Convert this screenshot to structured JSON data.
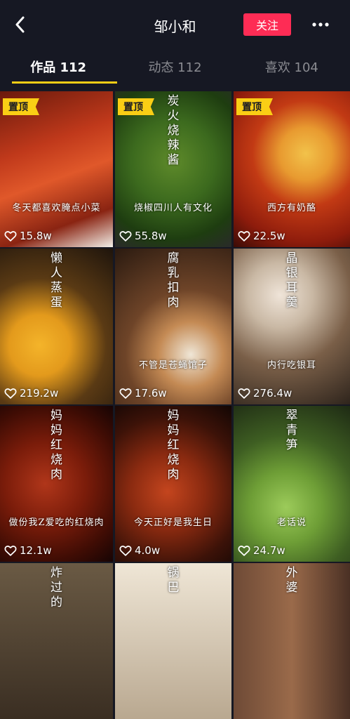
{
  "header": {
    "title": "邹小和",
    "follow_label": "关注",
    "back_icon": "chevron-left-icon",
    "more_icon": "more-dots-icon"
  },
  "tabs": [
    {
      "label": "作品 112",
      "active": true
    },
    {
      "label": "动态 112",
      "active": false
    },
    {
      "label": "喜欢 104",
      "active": false
    }
  ],
  "colors": {
    "background": "#161823",
    "accent_red": "#fe2c55",
    "tab_indicator": "#face15",
    "pin_badge": "#face15"
  },
  "videos": [
    {
      "pinned": "置顶",
      "vcaption": "",
      "hcaption": "冬天都喜欢腌点小菜",
      "likes": "15.8w",
      "bg": "linear-gradient(160deg,#6b1a0c 0%,#c0391b 35%,#e0582a 55%,#8a2412 80%,#f2efe8 100%)"
    },
    {
      "pinned": "置顶",
      "vcaption": "炭火烧辣酱",
      "hcaption": "烧椒四川人有文化",
      "likes": "55.8w",
      "bg": "radial-gradient(circle at 50% 45%,#5e8a2a 0%,#3c6a1e 40%,#1e3d10 75%,#2a2a2a 100%)"
    },
    {
      "pinned": "置顶",
      "vcaption": "",
      "hcaption": "西方有奶酪",
      "likes": "22.5w",
      "bg": "radial-gradient(circle at 62% 40%,#f2c24a 0%,#e89a30 22%,#c23a14 45%,#8e1c0c 75%,#3a0c06 100%)"
    },
    {
      "pinned": "",
      "vcaption": "懒人蒸蛋",
      "hcaption": "",
      "likes": "219.2w",
      "bg": "radial-gradient(circle at 35% 62%,#f4b42a 0%,#e39a1c 25%,#5a3a14 55%,#1e140c 100%)"
    },
    {
      "pinned": "",
      "vcaption": "腐乳扣肉",
      "hcaption": "不管是苍蝇馆子",
      "likes": "17.6w",
      "bg": "radial-gradient(circle at 65% 68%,#efe6d6 0%,#c48a54 25%,#6e4428 50%,#2a1a10 100%)"
    },
    {
      "pinned": "",
      "vcaption": "晶银耳羹",
      "hcaption": "内行吃银耳",
      "likes": "276.4w",
      "bg": "radial-gradient(circle at 40% 30%,#efe4d8 0%,#c9b8a4 25%,#7a5f48 55%,#2e241c 100%)"
    },
    {
      "pinned": "",
      "vcaption": "妈妈红烧肉",
      "hcaption": "做份我Z爱吃的红烧肉",
      "likes": "12.1w",
      "bg": "radial-gradient(circle at 40% 50%,#b0361a 0%,#7a1c0a 40%,#3e0c04 75%,#160404 100%)"
    },
    {
      "pinned": "",
      "vcaption": "妈妈红烧肉",
      "hcaption": "今天正好是我生日",
      "likes": "4.0w",
      "bg": "radial-gradient(circle at 45% 55%,#c4451e 0%,#8a2a10 35%,#3c1208 70%,#120604 100%)"
    },
    {
      "pinned": "",
      "vcaption": "翠青笋",
      "hcaption": "老话说",
      "likes": "24.7w",
      "bg": "radial-gradient(circle at 45% 65%,#9ccb5a 0%,#6e9e36 30%,#3e5e22 60%,#1e2a14 100%)"
    },
    {
      "pinned": "",
      "vcaption": "炸过的",
      "hcaption": "",
      "likes": "",
      "bg": "linear-gradient(180deg,#6a5a44 0%,#3a2e22 100%)"
    },
    {
      "pinned": "",
      "vcaption": "锅巴",
      "hcaption": "",
      "likes": "",
      "bg": "linear-gradient(180deg,#efe6d6 0%,#b9a890 100%)"
    },
    {
      "pinned": "",
      "vcaption": "外婆",
      "hcaption": "",
      "likes": "",
      "bg": "linear-gradient(90deg,#6e4a36 0%,#9a6a4a 50%,#4a3024 100%)"
    }
  ]
}
